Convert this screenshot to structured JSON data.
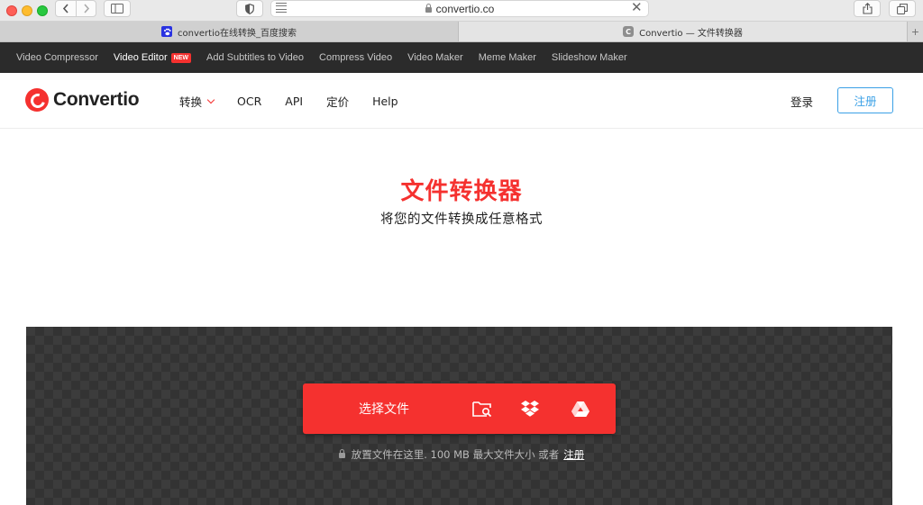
{
  "browser": {
    "url": "convertio.co",
    "tabs": [
      {
        "label": "convertio在线转换_百度搜索",
        "favicon": "baidu-paw-icon"
      },
      {
        "label": "Convertio — 文件转换器",
        "favicon": "convertio-c-icon",
        "favicon_letter": "C"
      }
    ],
    "new_tab_symbol": "+"
  },
  "promo_bar": {
    "items": [
      {
        "label": "Video Compressor"
      },
      {
        "label": "Video Editor",
        "badge": "NEW"
      },
      {
        "label": "Add Subtitles to Video"
      },
      {
        "label": "Compress Video"
      },
      {
        "label": "Video Maker"
      },
      {
        "label": "Meme Maker"
      },
      {
        "label": "Slideshow Maker"
      }
    ]
  },
  "header": {
    "logo_text": "Convertio",
    "nav": [
      {
        "label": "转换",
        "has_dropdown": true
      },
      {
        "label": "OCR"
      },
      {
        "label": "API"
      },
      {
        "label": "定价"
      },
      {
        "label": "Help"
      }
    ],
    "login_label": "登录",
    "signup_label": "注册"
  },
  "hero": {
    "title": "文件转换器",
    "subtitle": "将您的文件转换成任意格式"
  },
  "upload": {
    "choose_files_label": "选择文件",
    "sources": [
      "folder-search-icon",
      "dropbox-icon",
      "google-drive-icon"
    ],
    "note_text": "放置文件在这里. 100 MB 最大文件大小 或者",
    "note_link": "注册"
  },
  "colors": {
    "brand_red": "#f5312f",
    "accent_blue": "#3aa0e6",
    "promo_bar_bg": "#2b2b2b",
    "dropzone_bg": "#3c3c3c"
  }
}
